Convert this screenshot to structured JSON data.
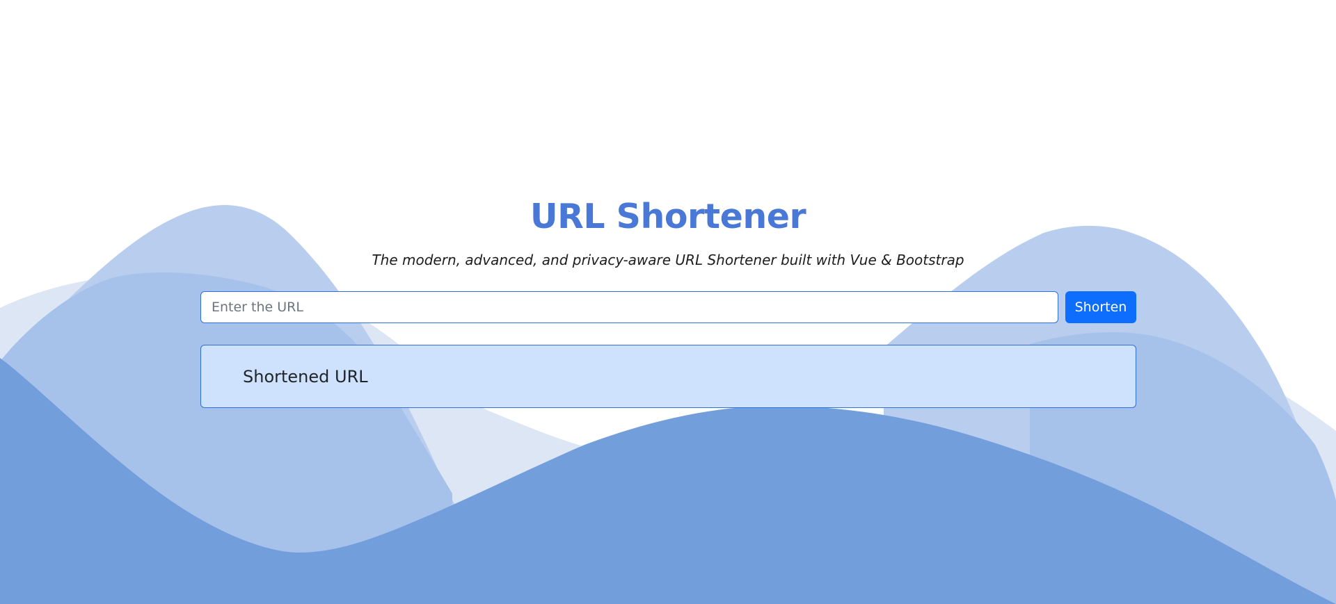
{
  "header": {
    "title": "URL Shortener",
    "subtitle": "The modern, advanced, and privacy-aware URL Shortener built with Vue & Bootstrap"
  },
  "form": {
    "url_placeholder": "Enter the URL",
    "url_value": "",
    "submit_label": "Shorten"
  },
  "result": {
    "label": "Shortened URL"
  },
  "colors": {
    "accent": "#4a78d6",
    "button": "#0d6efd",
    "result_background": "#cfe2fd",
    "wave_light": "#dce6f5",
    "wave_mid": "#b9cdee",
    "wave_mid_2": "#a7c2ea",
    "wave_dark": "#729edc"
  }
}
